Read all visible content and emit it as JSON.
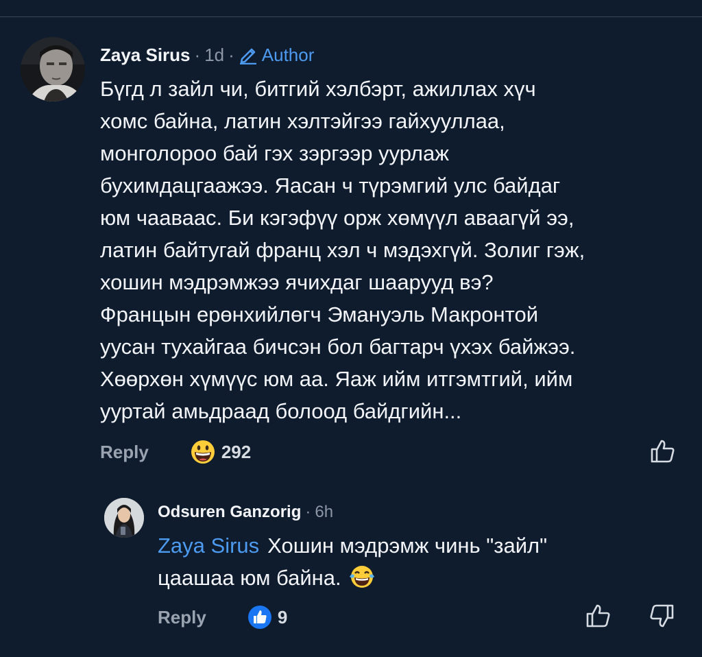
{
  "main_comment": {
    "author": "Zaya Sirus",
    "separator": "·",
    "time": "1d",
    "badge": "Author",
    "lines": [
      "Бүгд л зайл чи, битгий хэлбэрт, ажиллах хүч",
      "хомс байна, латин хэлтэйгээ гайхууллаа,",
      "монголороо бай гэх зэргээр уурлаж",
      "бухимдацгаажээ. Яасан ч түрэмгий улс байдаг",
      "юм чааваас. Би кэгэфүү орж хөмүүл аваагүй ээ,",
      "латин байтугай франц хэл ч мэдэхгүй. Золиг гэж,",
      "хошин мэдрэмжээ ячихдаг шаарууд вэ?",
      "Францын ерөнхийлөгч Эмануэль Макронтой",
      "уусан тухайгаа бичсэн бол багтарч үхэх байжээ.",
      "Хөөрхөн хүмүүс юм аа. Яаж ийм итгэмтгий, ийм",
      "ууртай амьдраад болоод байдгийн..."
    ],
    "reply_label": "Reply",
    "reaction_icon": "grinning-face-icon",
    "reaction_count": "292"
  },
  "reply_comment": {
    "author": "Odsuren Ganzorig",
    "separator": "·",
    "time": "6h",
    "mention": "Zaya Sirus",
    "line1": "Хошин мэдрэмж чинь \"зайл\"",
    "line2": "цаашаа юм байна.",
    "inline_emoji": "tears-of-joy-icon",
    "reply_label": "Reply",
    "reaction_icon": "like-icon",
    "reaction_count": "9"
  },
  "colors": {
    "background": "#0f1c2e",
    "accent": "#4d9bf0",
    "muted": "#8d97a6"
  }
}
